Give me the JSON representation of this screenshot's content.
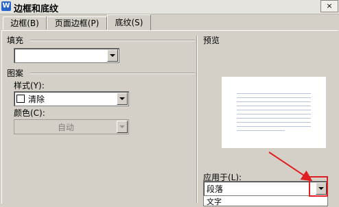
{
  "window": {
    "title": "边框和底纹",
    "app_icon_glyph": "W",
    "close_glyph": "×"
  },
  "tabs": [
    {
      "label": "边框(B)"
    },
    {
      "label": "页面边框(P)"
    },
    {
      "label": "底纹(S)",
      "active": true
    }
  ],
  "fill": {
    "label": "填充",
    "value": ""
  },
  "pattern": {
    "label": "图案",
    "style_label": "样式(Y):",
    "style_value": "清除",
    "color_label": "颜色(C):",
    "color_value": "自动"
  },
  "preview": {
    "label": "预览",
    "line_count": 10
  },
  "apply_to": {
    "label": "应用于(L):",
    "value": "段落",
    "dropdown_option": "文字"
  },
  "colors": {
    "annotation": "#e02020",
    "preview_lines": "#b8c4dc"
  }
}
